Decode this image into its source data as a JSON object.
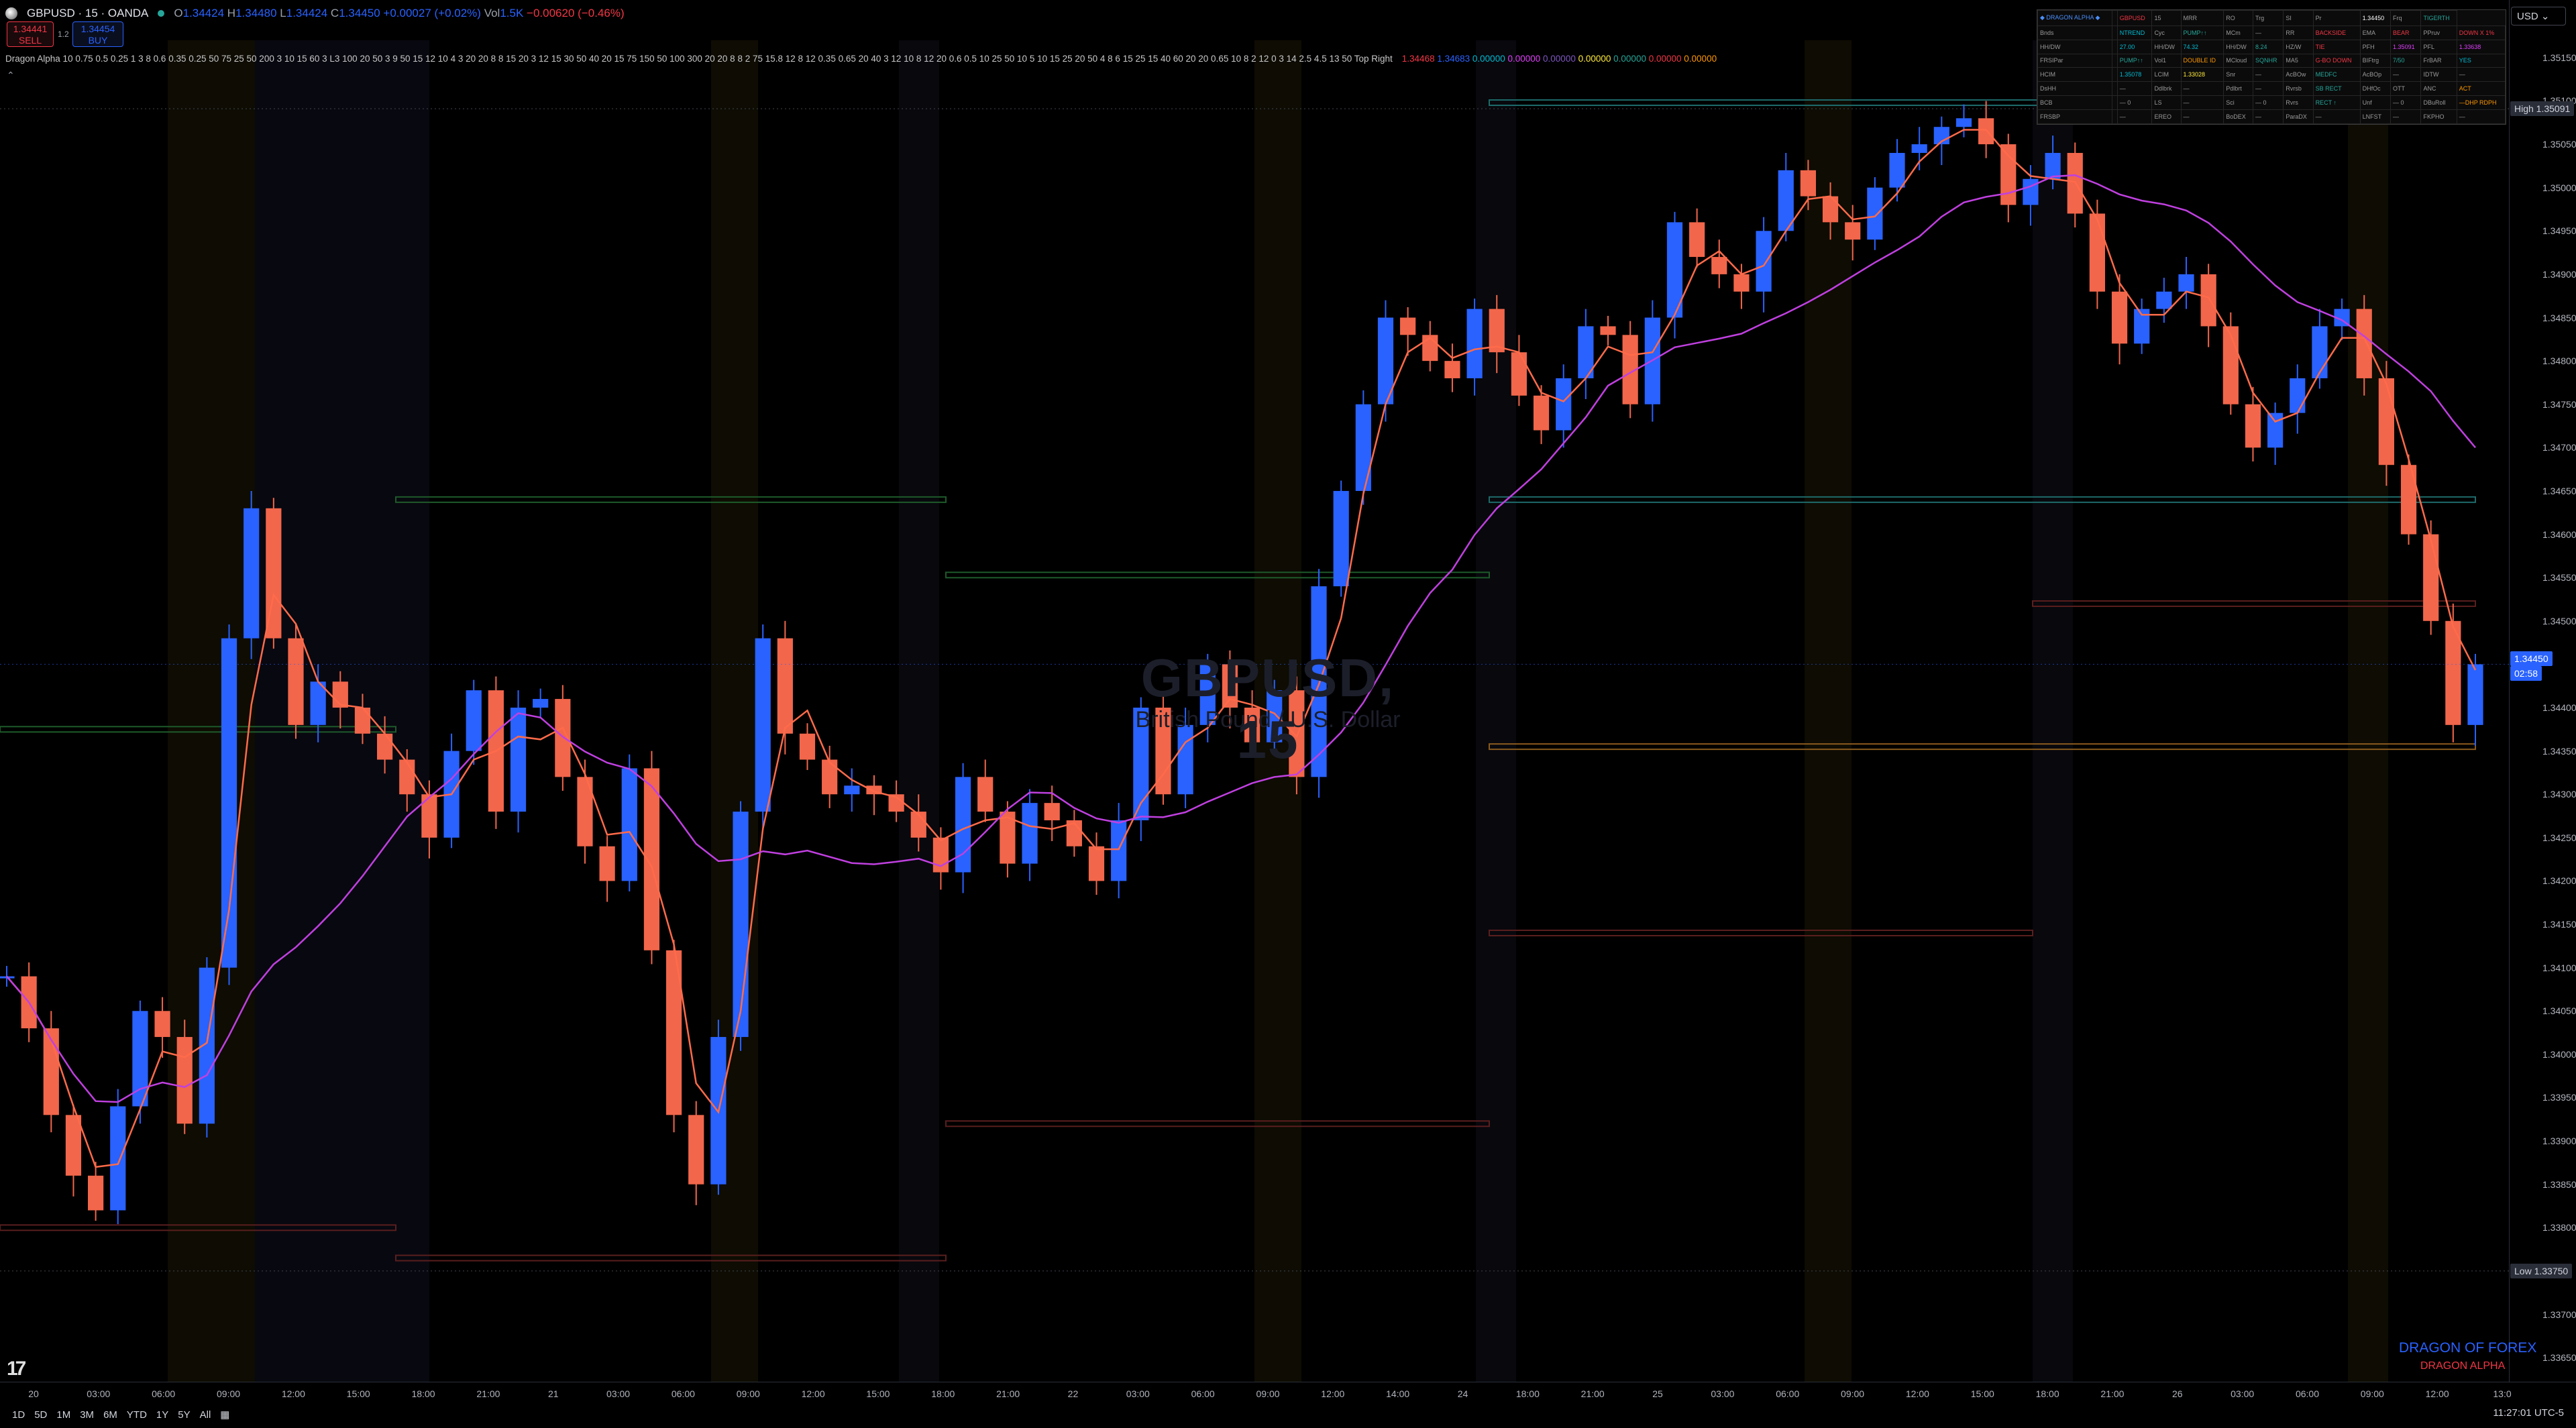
{
  "header": {
    "symbol_line": "GBPUSD · 15 · OANDA",
    "ohlc": {
      "o_label": "O",
      "o": "1.34424",
      "h_label": "H",
      "h": "1.34480",
      "l_label": "L",
      "l": "1.34424",
      "c_label": "C",
      "c": "1.34450",
      "change": "+0.00027 (+0.02%)",
      "vol_label": "Vol",
      "vol": "1.5K",
      "day_change": "−0.00620 (−0.46%)"
    },
    "sell": {
      "price": "1.34441",
      "label": "SELL"
    },
    "spread": "1.2",
    "buy": {
      "price": "1.34454",
      "label": "BUY"
    },
    "indicator_line": "Dragon Alpha 10 0.75 0.5 0.25 1 3 8 0.6 0.35 0.25 50 75 25 50 200 3 10 15 60 3 L3 100 20 50 3 9 50 15 12 10 4 3 20 20 8 8 15 20 3 12 15 30 50 40 20 15 75 150 50 100 300 20 20 8 8 2 75 15.8 12 8 12 0.35 0.65 20 40 3 12 10 8 12 20 0.6 0.5 10 25 50 10 5 10 15 25 20 50 4 8 6 15 25 15 40 60 20 20 0.65 10 8 2 12 0 3 14 2.5 4.5 13 50 Top Right",
    "indicator_values": [
      {
        "text": "1.34468",
        "color": "#f23645"
      },
      {
        "text": "1.34683",
        "color": "#2962ff"
      },
      {
        "text": "0.00000",
        "color": "#00bcd4"
      },
      {
        "text": "0.00000",
        "color": "#e040fb"
      },
      {
        "text": "0.00000",
        "color": "#7e57c2"
      },
      {
        "text": "0.00000",
        "color": "#ffeb3b"
      },
      {
        "text": "0.00000",
        "color": "#26a69a"
      },
      {
        "text": "0.00000",
        "color": "#f23645"
      },
      {
        "text": "0.00000",
        "color": "#ff9800"
      }
    ]
  },
  "watermark": {
    "symbol": "GBPUSD, 15",
    "name": "British Pound / U.S. Dollar"
  },
  "currency": "USD",
  "price_axis": {
    "ticks": [
      "1.35150",
      "1.35100",
      "1.35050",
      "1.35000",
      "1.34950",
      "1.34900",
      "1.34850",
      "1.34800",
      "1.34750",
      "1.34700",
      "1.34650",
      "1.34600",
      "1.34550",
      "1.34500",
      "1.34400",
      "1.34350",
      "1.34300",
      "1.34250",
      "1.34200",
      "1.34150",
      "1.34100",
      "1.34050",
      "1.34000",
      "1.33950",
      "1.33900",
      "1.33850",
      "1.33800",
      "1.33700",
      "1.33650"
    ],
    "high_label": "High",
    "high_value": "1.35091",
    "low_label": "Low",
    "low_value": "1.33750",
    "current_price": "1.34450",
    "countdown": "02:58"
  },
  "time_axis": {
    "labels": [
      "20",
      "03:00",
      "06:00",
      "09:00",
      "12:00",
      "15:00",
      "18:00",
      "21:00",
      "21",
      "03:00",
      "06:00",
      "09:00",
      "12:00",
      "15:00",
      "18:00",
      "21:00",
      "22",
      "03:00",
      "06:00",
      "09:00",
      "12:00",
      "14:00",
      "24",
      "18:00",
      "21:00",
      "25",
      "03:00",
      "06:00",
      "09:00",
      "12:00",
      "15:00",
      "18:00",
      "21:00",
      "26",
      "03:00",
      "06:00",
      "09:00",
      "12:00",
      "13:0"
    ]
  },
  "bottom_toolbar": {
    "ranges": [
      "1D",
      "5D",
      "1M",
      "3M",
      "6M",
      "YTD",
      "1Y",
      "5Y",
      "All"
    ],
    "clock": "11:27:01 UTC-5"
  },
  "branding": {
    "line1": "DRAGON OF FOREX",
    "line2": "DRAGON ALPHA"
  },
  "alpha_panel": {
    "rows": [
      [
        {
          "t": "◆ DRAGON ALPHA ◆",
          "c": "c-blue"
        },
        {
          "t": ""
        },
        {
          "t": "GBPUSD",
          "c": "c-red"
        },
        {
          "t": "15"
        },
        {
          "t": "MRR"
        },
        {
          "t": "RO"
        },
        {
          "t": "Trg"
        },
        {
          "t": "SI"
        },
        {
          "t": "Pr"
        },
        {
          "t": "1.34450",
          "c": "c-white"
        },
        {
          "t": "Frq"
        },
        {
          "t": "TIGERTH",
          "c": "c-green"
        }
      ],
      [
        {
          "t": "Bnds"
        },
        {
          "t": ""
        },
        {
          "t": "NTREND",
          "c": "c-cyan"
        },
        {
          "t": "Cyc"
        },
        {
          "t": "PUMP↑↑",
          "c": "c-green"
        },
        {
          "t": "MCm"
        },
        {
          "t": "—"
        },
        {
          "t": "RR"
        },
        {
          "t": "BACKSIDE",
          "c": "c-red"
        },
        {
          "t": "EMA"
        },
        {
          "t": "BEAR",
          "c": "c-red"
        },
        {
          "t": "PPruv"
        },
        {
          "t": "DOWN X 1%",
          "c": "c-red"
        }
      ],
      [
        {
          "t": "HH/DW"
        },
        {
          "t": ""
        },
        {
          "t": "27.00",
          "c": "c-cyan"
        },
        {
          "t": "HH/DW"
        },
        {
          "t": "74.32",
          "c": "c-cyan"
        },
        {
          "t": "HH/DW"
        },
        {
          "t": "8.24",
          "c": "c-green"
        },
        {
          "t": "HZ/W"
        },
        {
          "t": "TIE",
          "c": "c-red"
        },
        {
          "t": "PFH"
        },
        {
          "t": "1.35091",
          "c": "c-purple"
        },
        {
          "t": "PFL"
        },
        {
          "t": "1.33638",
          "c": "c-purple"
        }
      ],
      [
        {
          "t": "FRSIPar"
        },
        {
          "t": ""
        },
        {
          "t": "PUMP↑↑",
          "c": "c-green"
        },
        {
          "t": "Vol1"
        },
        {
          "t": "DOUBLE ID",
          "c": "c-orange"
        },
        {
          "t": "MCloud"
        },
        {
          "t": "SQNHR",
          "c": "c-green"
        },
        {
          "t": "MA5"
        },
        {
          "t": "G-BO DOWN",
          "c": "c-red"
        },
        {
          "t": "BIFtrg"
        },
        {
          "t": "7/50",
          "c": "c-green"
        },
        {
          "t": "FrBAR"
        },
        {
          "t": "YES",
          "c": "c-cyan"
        }
      ],
      [
        {
          "t": "HCIM"
        },
        {
          "t": ""
        },
        {
          "t": "1.35078",
          "c": "c-cyan"
        },
        {
          "t": "LCIM"
        },
        {
          "t": "1.33028",
          "c": "c-yellow"
        },
        {
          "t": "Snr"
        },
        {
          "t": "—"
        },
        {
          "t": "AcBOw"
        },
        {
          "t": "MEDFC",
          "c": "c-green"
        },
        {
          "t": "AcBOp"
        },
        {
          "t": "—"
        },
        {
          "t": "IDTW"
        },
        {
          "t": "—"
        }
      ],
      [
        {
          "t": "DsHH"
        },
        {
          "t": ""
        },
        {
          "t": "—"
        },
        {
          "t": "Ddlbrk"
        },
        {
          "t": "—"
        },
        {
          "t": "Pdlbrt"
        },
        {
          "t": "—"
        },
        {
          "t": "Rvrsb"
        },
        {
          "t": "SB RECT",
          "c": "c-green"
        },
        {
          "t": "DHfOc"
        },
        {
          "t": "OTT"
        },
        {
          "t": "ANC"
        },
        {
          "t": "ACT",
          "c": "c-orange"
        }
      ],
      [
        {
          "t": "BCB"
        },
        {
          "t": ""
        },
        {
          "t": "— 0"
        },
        {
          "t": "LS"
        },
        {
          "t": "—"
        },
        {
          "t": "Sci"
        },
        {
          "t": "— 0"
        },
        {
          "t": "Rvrs"
        },
        {
          "t": "RECT ↑",
          "c": "c-green"
        },
        {
          "t": "Unf"
        },
        {
          "t": "— 0"
        },
        {
          "t": "DBuRoll"
        },
        {
          "t": "—DHP RDPH",
          "c": "c-orange"
        }
      ],
      [
        {
          "t": "FRSBP"
        },
        {
          "t": ""
        },
        {
          "t": "—"
        },
        {
          "t": "EREO"
        },
        {
          "t": "—"
        },
        {
          "t": "BoDEX"
        },
        {
          "t": "—"
        },
        {
          "t": "ParaDX"
        },
        {
          "t": "—"
        },
        {
          "t": "LNFST"
        },
        {
          "t": "—"
        },
        {
          "t": "FKPHO"
        },
        {
          "t": "—"
        }
      ]
    ]
  },
  "colors": {
    "bull": "#2962ff",
    "bear": "#f2664b",
    "fast_ma": "#ff6b4a",
    "slow_ma": "#c040e0",
    "bg": "#000000"
  },
  "chart_data": {
    "type": "candlestick",
    "symbol": "GBPUSD",
    "timeframe": "15",
    "ylim": [
      1.3363,
      1.3517
    ],
    "session_high": 1.35091,
    "session_low": 1.3375,
    "current": 1.3445,
    "series": [
      {
        "name": "price",
        "values": [
          1.3409,
          1.3403,
          1.3393,
          1.3386,
          1.3382,
          1.3394,
          1.3405,
          1.3402,
          1.3392,
          1.341,
          1.3448,
          1.3463,
          1.3448,
          1.3438,
          1.3443,
          1.344,
          1.3437,
          1.3434,
          1.343,
          1.3425,
          1.3435,
          1.3442,
          1.3428,
          1.344,
          1.3441,
          1.3432,
          1.3424,
          1.342,
          1.3433,
          1.3412,
          1.3393,
          1.3385,
          1.3402,
          1.3428,
          1.3448,
          1.3437,
          1.3434,
          1.343,
          1.3431,
          1.343,
          1.3428,
          1.3425,
          1.3421,
          1.3432,
          1.3428,
          1.3422,
          1.3429,
          1.3427,
          1.3424,
          1.342,
          1.3427,
          1.344,
          1.343,
          1.3438,
          1.3445,
          1.344,
          1.3436,
          1.3442,
          1.3432,
          1.3454,
          1.3465,
          1.3475,
          1.3485,
          1.3483,
          1.348,
          1.3478,
          1.3486,
          1.3481,
          1.3476,
          1.3472,
          1.3478,
          1.3484,
          1.3483,
          1.3475,
          1.3485,
          1.3496,
          1.3492,
          1.349,
          1.3488,
          1.3495,
          1.3502,
          1.3499,
          1.3496,
          1.3494,
          1.35,
          1.3504,
          1.3505,
          1.3507,
          1.3508,
          1.3505,
          1.3498,
          1.3501,
          1.3504,
          1.3497,
          1.3488,
          1.3482,
          1.3486,
          1.3488,
          1.349,
          1.3484,
          1.3475,
          1.347,
          1.3474,
          1.3478,
          1.3484,
          1.3486,
          1.3478,
          1.3468,
          1.346,
          1.345,
          1.3438,
          1.3445
        ]
      }
    ]
  }
}
